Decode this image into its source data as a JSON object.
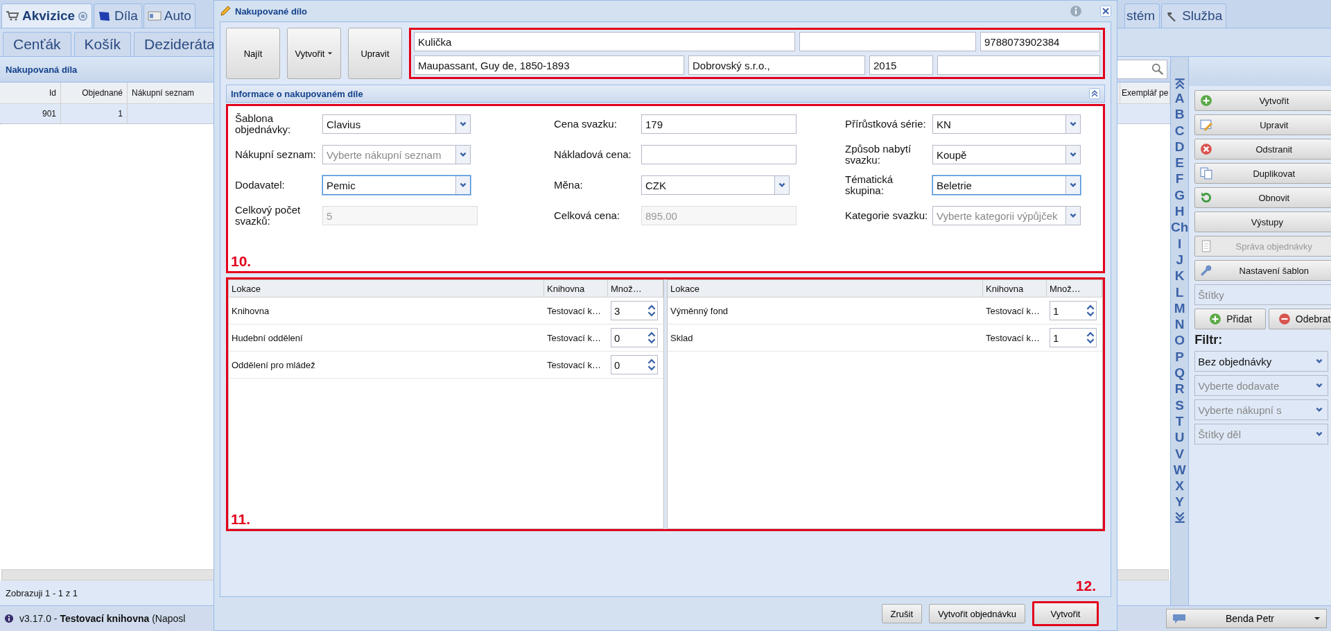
{
  "app_tabs": [
    {
      "label": "Akvizice",
      "selected": true,
      "help": true
    },
    {
      "label": "Díla",
      "selected": false,
      "help": false
    },
    {
      "label": "Auto",
      "selected": false,
      "help": false
    }
  ],
  "app_tabs_right": [
    {
      "label": "stém",
      "selected": false
    },
    {
      "label": "Služba",
      "selected": false
    }
  ],
  "sub_tabs": [
    {
      "label": "Cenťák",
      "selected": false
    },
    {
      "label": "Košík",
      "selected": false
    },
    {
      "label": "Dezideráta",
      "selected": false
    }
  ],
  "list_panel": {
    "title": "Nakupovaná díla",
    "columns": [
      "Id",
      "Objednané",
      "Nákupní seznam",
      "Exemplář pe"
    ],
    "rows": [
      [
        "901",
        "1"
      ]
    ],
    "footer": "Zobrazuji 1 - 1 z 1"
  },
  "alphabet": [
    "A",
    "B",
    "C",
    "D",
    "E",
    "F",
    "G",
    "H",
    "Ch",
    "I",
    "J",
    "K",
    "L",
    "M",
    "N",
    "O",
    "P",
    "Q",
    "R",
    "S",
    "T",
    "U",
    "V",
    "W",
    "X",
    "Y"
  ],
  "side_buttons": [
    {
      "label": "Vytvořit",
      "kind": "plus",
      "disabled": false
    },
    {
      "label": "Upravit",
      "kind": "edit",
      "disabled": false
    },
    {
      "label": "Odstranit",
      "kind": "delete",
      "disabled": false
    },
    {
      "label": "Duplikovat",
      "kind": "copy",
      "disabled": false
    },
    {
      "label": "Obnovit",
      "kind": "refresh",
      "disabled": false
    },
    {
      "label": "Výstupy",
      "kind": "plain",
      "disabled": false
    },
    {
      "label": "Správa objednávky",
      "kind": "document",
      "disabled": true
    },
    {
      "label": "Nastavení šablon",
      "kind": "wrench",
      "disabled": false
    }
  ],
  "tags_field": {
    "placeholder": "Štítky"
  },
  "tag_buttons": [
    {
      "label": "Přidat",
      "kind": "plus"
    },
    {
      "label": "Odebrat",
      "kind": "minus"
    }
  ],
  "filter": {
    "label": "Filtr:",
    "fields": [
      {
        "value": "Bez objednávky"
      },
      {
        "placeholder": "Vyberte dodavate"
      },
      {
        "placeholder": "Vyberte nákupní s"
      },
      {
        "placeholder": "Štítky děl"
      }
    ]
  },
  "status_bar": {
    "text": "v3.17.0 - **Testovací knihovna** (Naposl",
    "user": "Benda Petr"
  },
  "dialog": {
    "title": "Nakupované dílo",
    "toolbar": [
      {
        "label": "Najít",
        "menu": false
      },
      {
        "label": "Vytvořit",
        "menu": true
      },
      {
        "label": "Upravit",
        "menu": false
      }
    ],
    "summary_rows": [
      [
        {
          "value": "Kulička"
        },
        {},
        {
          "value": "9788073902384"
        }
      ],
      [
        {
          "value": "Maupassant, Guy de, 1850-1893"
        },
        {
          "value": "Dobrovský s.r.o.,"
        },
        {
          "value": "2015"
        },
        {}
      ]
    ],
    "section": {
      "title": "Informace o nakupovaném díle",
      "mark": "10."
    },
    "form_columns": [
      [
        {
          "label": "Šablona objednávky:",
          "value": "Clavius",
          "kind": "combo",
          "disabled": false,
          "focused": false
        },
        {
          "label": "Nákupní seznam:",
          "placeholder": "Vyberte nákupní seznam",
          "kind": "combo",
          "disabled": false,
          "focused": false
        },
        {
          "label": "Dodavatel:",
          "value": "Pemic",
          "kind": "combo",
          "disabled": false,
          "focused": true
        },
        {
          "label": "Celkový počet svazků:",
          "value": "5",
          "kind": "text",
          "disabled": true,
          "focused": false
        }
      ],
      [
        {
          "label": "Cena svazku:",
          "value": "179",
          "kind": "text",
          "disabled": false,
          "focused": false
        },
        {
          "label": "Nákladová cena:",
          "kind": "text",
          "disabled": false,
          "focused": false
        },
        {
          "label": "Měna:",
          "value": "CZK",
          "kind": "combo",
          "disabled": false,
          "focused": false
        },
        {
          "label": "Celková cena:",
          "value": "895.00",
          "kind": "text",
          "disabled": true,
          "focused": false
        }
      ],
      [
        {
          "label": "Přírůstková série:",
          "value": "KN",
          "kind": "combo",
          "disabled": false,
          "focused": false
        },
        {
          "label": "Způsob nabytí svazku:",
          "value": "Koupě",
          "kind": "combo",
          "disabled": false,
          "focused": false
        },
        {
          "label": "Tématická skupina:",
          "value": "Beletrie",
          "kind": "combo",
          "disabled": false,
          "focused": true
        },
        {
          "label": "Kategorie svazku:",
          "placeholder": "Vyberte kategorii výpůjček",
          "kind": "combo",
          "disabled": false,
          "focused": false
        }
      ]
    ],
    "locations": {
      "mark": "11.",
      "tables": [
        {
          "columns": [
            "Lokace",
            "Knihovna",
            "Množ…"
          ],
          "rows": [
            {
              "location": "Knihovna",
              "library": "Testovací k…",
              "count": "3"
            },
            {
              "location": "Hudební oddělení",
              "library": "Testovací k…",
              "count": "0"
            },
            {
              "location": "Oddělení pro mládež",
              "library": "Testovací k…",
              "count": "0"
            }
          ]
        },
        {
          "columns": [
            "Lokace",
            "Knihovna",
            "Množ…"
          ],
          "rows": [
            {
              "location": "Výměnný fond",
              "library": "Testovací k…",
              "count": "1"
            },
            {
              "location": "Sklad",
              "library": "Testovací k…",
              "count": "1"
            }
          ]
        }
      ]
    },
    "buttons": [
      {
        "label": "Zrušit",
        "highlighted": false
      },
      {
        "label": "Vytvořit objednávku",
        "highlighted": false
      },
      {
        "label": "Vytvořit",
        "highlighted": true,
        "mark": "12."
      }
    ]
  }
}
